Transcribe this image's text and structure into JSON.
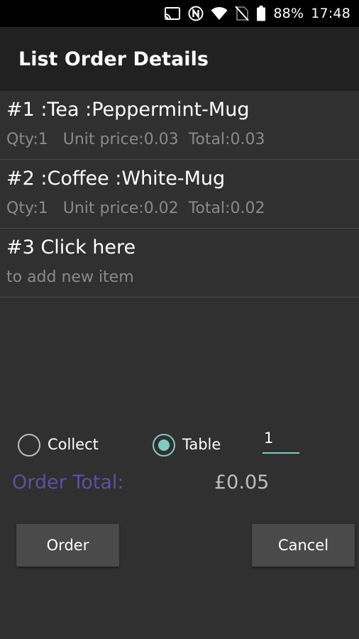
{
  "status_bar": {
    "battery": "88%",
    "time": "17:48",
    "icons": [
      "cast-icon",
      "nfc-icon",
      "wifi-icon",
      "no-sim-icon",
      "battery-icon"
    ]
  },
  "action_bar": {
    "title": "List Order Details"
  },
  "order_items": [
    {
      "primary": "#1 :Tea :Peppermint-Mug",
      "secondary": "Qty:1   Unit price:0.03  Total:0.03"
    },
    {
      "primary": "#2 :Coffee :White-Mug",
      "secondary": "Qty:1   Unit price:0.02  Total:0.02"
    },
    {
      "primary": "#3 Click here",
      "secondary": "to add new item"
    }
  ],
  "delivery": {
    "collect_label": "Collect",
    "table_label": "Table",
    "selected": "Table",
    "table_number": "1"
  },
  "order_total": {
    "label": "Order Total:",
    "value": "£0.05"
  },
  "buttons": {
    "order_label": "Order",
    "cancel_label": "Cancel"
  },
  "colors": {
    "background": "#303030",
    "action_bar": "#212121",
    "accent": "#80cbc4",
    "total_label": "#5c4fa8"
  }
}
